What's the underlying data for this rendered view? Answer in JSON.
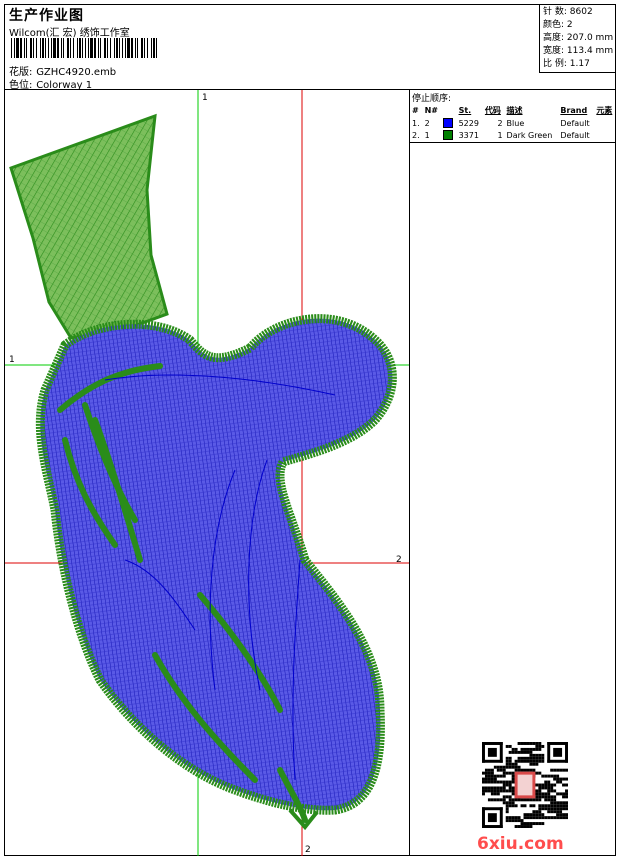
{
  "header": {
    "title": "生产作业图",
    "subtitle": "Wilcom(汇 宏) 绣饰工作室",
    "design_label": "花版:",
    "design_value": "GZHC4920.emb",
    "colorway_label": "色位:",
    "colorway_value": "Colorway 1"
  },
  "stats": [
    {
      "label": "针 数:",
      "value": "8602"
    },
    {
      "label": "颜色:",
      "value": "2"
    },
    {
      "label": "高度:",
      "value": "207.0 mm"
    },
    {
      "label": "宽度:",
      "value": "113.4 mm"
    },
    {
      "label": "比 例:",
      "value": "1.17"
    }
  ],
  "stop_sequence": {
    "title": "停止顺序:",
    "columns": [
      "#",
      "N#",
      "St.",
      "代码",
      "描述",
      "Brand",
      "元素"
    ],
    "rows": [
      {
        "num": "1.",
        "n": "2",
        "color": "#0000ff",
        "stitches": "5229",
        "code": "2",
        "desc": "Blue",
        "brand": "Default"
      },
      {
        "num": "2.",
        "n": "1",
        "color": "#008000",
        "stitches": "3371",
        "code": "1",
        "desc": "Dark Green",
        "brand": "Default"
      }
    ]
  },
  "guides": {
    "v1": "1",
    "h1": "1",
    "v2": "2",
    "h2": "2"
  },
  "colors": {
    "blue_fill": "#3a3ad8",
    "green": "#2a8c1a",
    "guide_green": "#00cc00",
    "guide_red": "#dd0000"
  },
  "watermark": "6xiu.com"
}
